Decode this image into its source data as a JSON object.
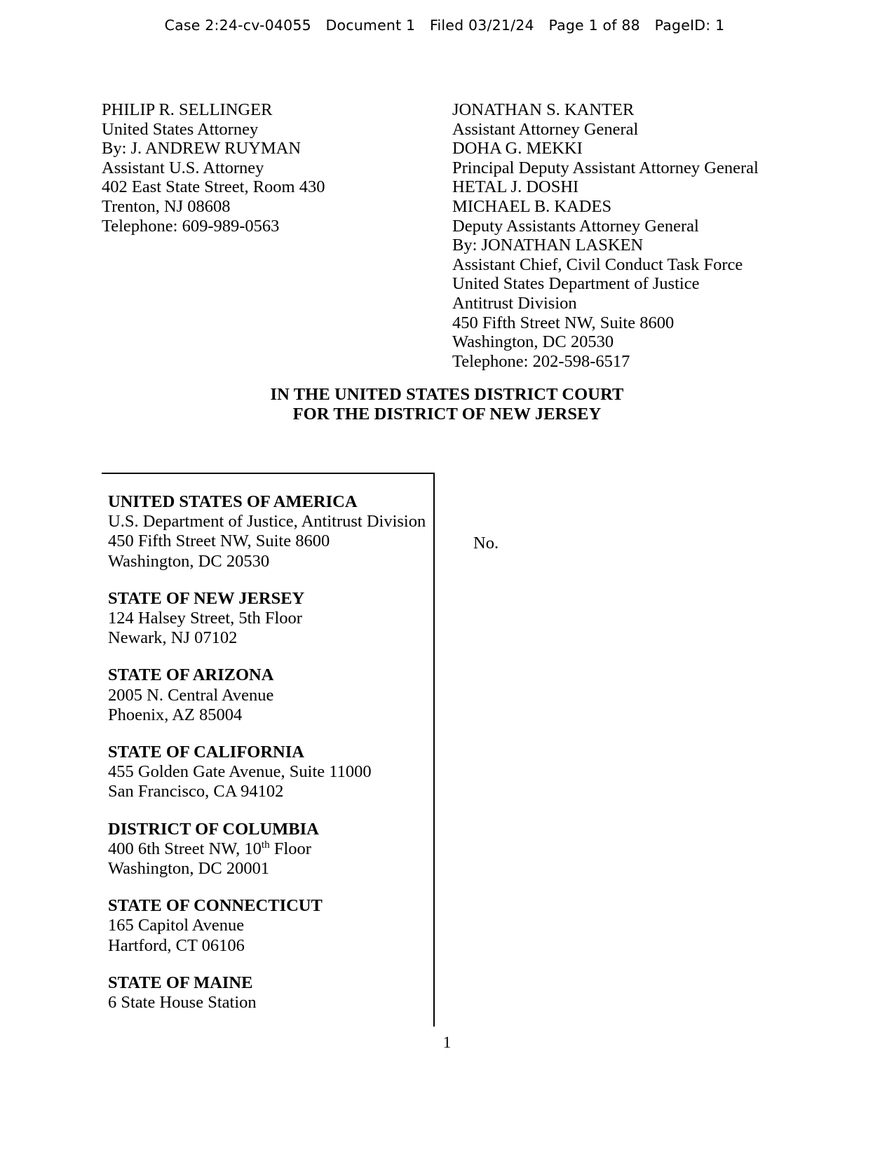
{
  "ecf_header": {
    "case": "Case 2:24-cv-04055",
    "document": "Document 1",
    "filed": "Filed 03/21/24",
    "page": "Page 1 of 88",
    "pageid": "PageID: 1"
  },
  "counsel": {
    "left": [
      "PHILIP R. SELLINGER",
      "United States Attorney",
      "By: J. ANDREW RUYMAN",
      "Assistant U.S. Attorney",
      "402 East State Street, Room 430",
      "Trenton, NJ 08608",
      "Telephone: 609-989-0563"
    ],
    "right": [
      "JONATHAN S. KANTER",
      "Assistant Attorney General",
      "DOHA G. MEKKI",
      "Principal Deputy Assistant Attorney General",
      "HETAL J. DOSHI",
      "MICHAEL B. KADES",
      "Deputy Assistants Attorney General",
      "By: JONATHAN LASKEN",
      "Assistant Chief, Civil Conduct Task Force",
      "United States Department of Justice",
      "Antitrust Division",
      "450 Fifth Street NW, Suite 8600",
      "Washington, DC 20530",
      "Telephone: 202-598-6517"
    ]
  },
  "court_title": {
    "line1": "IN THE UNITED STATES DISTRICT COURT",
    "line2": "FOR THE DISTRICT OF NEW JERSEY"
  },
  "caption": {
    "case_number_label": "No.",
    "parties": [
      {
        "name": "UNITED STATES OF AMERICA",
        "lines": [
          "U.S. Department of Justice, Antitrust Division",
          "450 Fifth Street NW, Suite 8600",
          "Washington, DC 20530"
        ]
      },
      {
        "name": "STATE OF NEW JERSEY",
        "lines": [
          "124 Halsey Street, 5th Floor",
          "Newark, NJ 07102"
        ]
      },
      {
        "name": "STATE OF ARIZONA",
        "lines": [
          "2005 N. Central Avenue",
          "Phoenix, AZ 85004"
        ]
      },
      {
        "name": "STATE OF CALIFORNIA",
        "lines": [
          "455 Golden Gate Avenue, Suite 11000",
          "San Francisco, CA 94102"
        ]
      },
      {
        "name": "DISTRICT OF COLUMBIA",
        "lines_html": [
          "400 6th Street NW, 10<sup>th</sup> Floor",
          "Washington, DC 20001"
        ]
      },
      {
        "name": "STATE OF CONNECTICUT",
        "lines": [
          "165 Capitol Avenue",
          "Hartford, CT 06106"
        ]
      },
      {
        "name": "STATE OF MAINE",
        "lines": [
          "6 State House Station"
        ]
      }
    ]
  },
  "footer": {
    "page_number": "1"
  }
}
